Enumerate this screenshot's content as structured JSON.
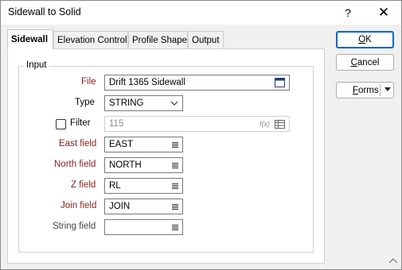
{
  "window": {
    "title": "Sidewall to Solid",
    "help_label": "?",
    "close_label": "✕"
  },
  "tabs": [
    {
      "label": "Sidewall",
      "active": true
    },
    {
      "label": "Elevation Control",
      "active": false
    },
    {
      "label": "Profile Shape",
      "active": false
    },
    {
      "label": "Output",
      "active": false
    }
  ],
  "input_group": {
    "legend": "Input",
    "file": {
      "label": "File",
      "value": "Drift 1365 Sidewall",
      "icon": "file-browse-icon"
    },
    "type": {
      "label": "Type",
      "value": "STRING",
      "icon": "chevron-down-icon"
    },
    "filter": {
      "label": "Filter",
      "checked": false,
      "value": "115",
      "fx_label": "f(x)",
      "icon": "grid-icon"
    },
    "east_field": {
      "label": "East field",
      "value": "EAST"
    },
    "north_field": {
      "label": "North field",
      "value": "NORTH"
    },
    "z_field": {
      "label": "Z field",
      "value": "RL"
    },
    "join_field": {
      "label": "Join field",
      "value": "JOIN"
    },
    "string_field": {
      "label": "String field",
      "value": ""
    }
  },
  "buttons": {
    "ok": {
      "label": "OK",
      "mnemonic": "O",
      "rest": "K"
    },
    "cancel": {
      "label": "Cancel",
      "mnemonic": "C",
      "rest": "ancel"
    },
    "forms": {
      "label": "Forms",
      "mnemonic": "F",
      "rest": "orms",
      "icon": "dropdown-arrow-icon"
    }
  },
  "colors": {
    "required_label": "#8b1a1a",
    "default_button_border": "#0067c0",
    "panel_background": "#ffffff",
    "dialog_background": "#f0f0f0"
  }
}
